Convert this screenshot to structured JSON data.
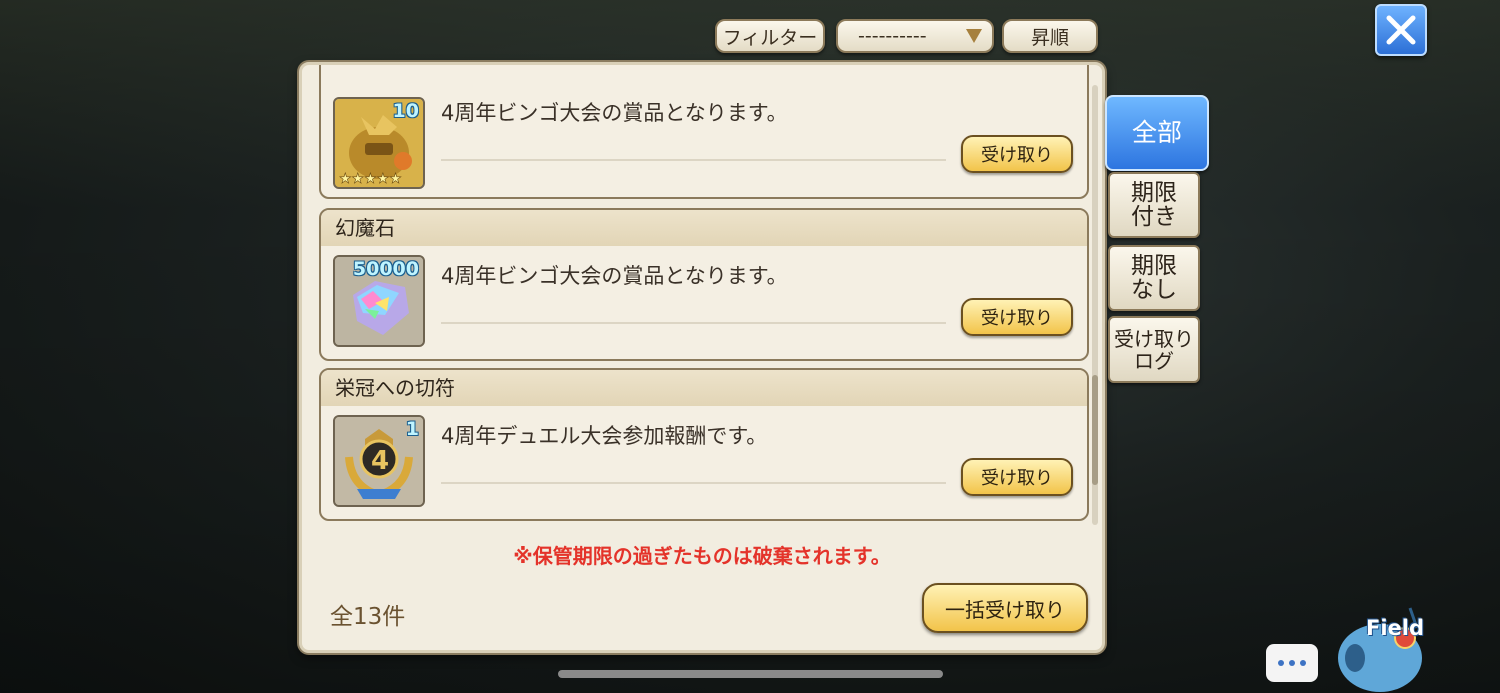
{
  "toolbar": {
    "filter_label": "フィルター",
    "sort_value": "----------",
    "order_label": "昇順"
  },
  "items": [
    {
      "title": "",
      "qty": "10",
      "description": "4周年ビンゴ大会の賞品となります。",
      "button": "受け取り",
      "icon": "treasure-bag-icon"
    },
    {
      "title": "幻魔石",
      "qty": "50000",
      "description": "4周年ビンゴ大会の賞品となります。",
      "button": "受け取り",
      "icon": "crystal-icon"
    },
    {
      "title": "栄冠への切符",
      "qty": "1",
      "description": "4周年デュエル大会参加報酬です。",
      "button": "受け取り",
      "icon": "laurel-medal-icon"
    }
  ],
  "notice": "※保管期限の過ぎたものは破棄されます。",
  "total": "全13件",
  "bulk_receive": "一括受け取り",
  "tabs": {
    "all": "全部",
    "expiring": "期限\n付き",
    "no_expiry": "期限\nなし",
    "log": "受け取り\nログ"
  },
  "field_label": "Field",
  "colors": {
    "accent_blue": "#2d75e0",
    "gold_button": "#f2c44a",
    "notice_red": "#e4332a"
  }
}
